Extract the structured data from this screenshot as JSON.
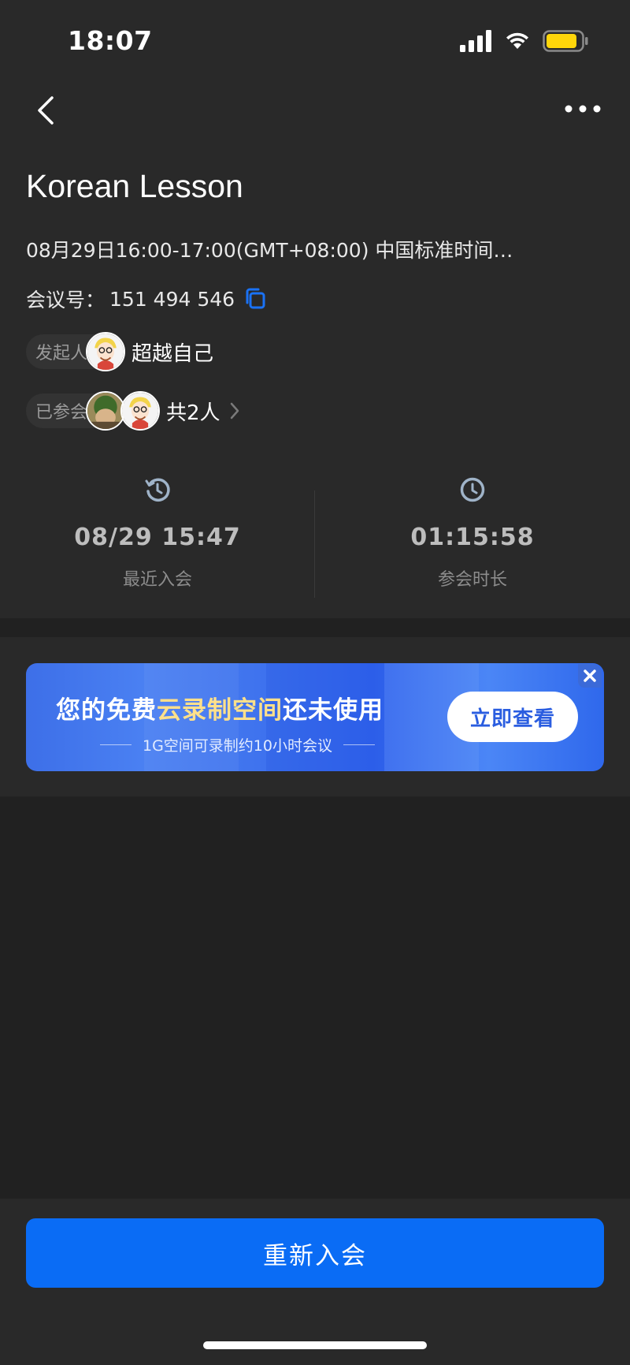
{
  "status_bar": {
    "time": "18:07",
    "icons": [
      "signal-icon",
      "wifi-icon",
      "battery-icon"
    ],
    "battery_color": "#ffd60a"
  },
  "nav": {
    "back_icon": "chevron-left-icon",
    "more_icon": "more-dots-icon"
  },
  "meeting": {
    "title": "Korean Lesson",
    "time_text": "08月29日16:00-17:00(GMT+08:00) 中国标准时间…",
    "number_label": "会议号：",
    "number": "151 494 546",
    "copy_icon": "copy-icon",
    "copy_icon_color": "#1a72f5"
  },
  "organizer": {
    "label": "发起人",
    "name": "超越自己"
  },
  "participants": {
    "label": "已参会",
    "count_text": "共2人"
  },
  "stats": {
    "last_join": {
      "icon": "history-clock-icon",
      "value": "08/29 15:47",
      "label": "最近入会"
    },
    "duration": {
      "icon": "clock-icon",
      "value": "01:15:58",
      "label": "参会时长"
    }
  },
  "banner": {
    "title_pre": "您的免费",
    "title_highlight": "云录制空间",
    "title_post": "还未使用",
    "subtitle": "1G空间可录制约10小时会议",
    "button_label": "立即查看",
    "close_icon": "close-icon",
    "highlight_color": "#ffe08a"
  },
  "actions": {
    "rejoin_label": "重新入会",
    "rejoin_color": "#0a6cf5"
  }
}
